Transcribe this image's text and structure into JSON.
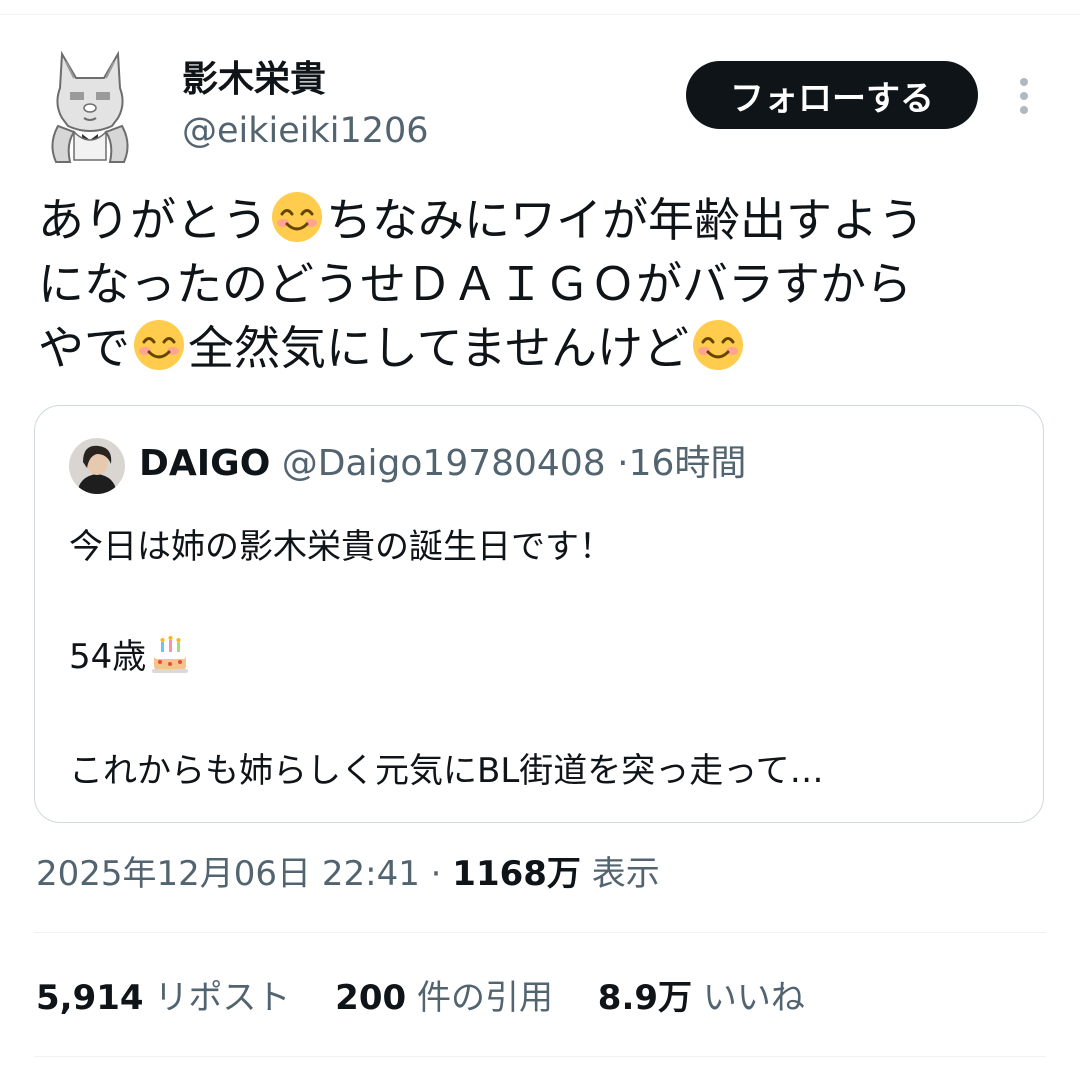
{
  "author": {
    "name": "影木栄貴",
    "handle": "@eikieiki1206",
    "follow_label": "フォローする"
  },
  "tweet": {
    "lines": [
      [
        "ありがとう",
        "",
        "ちなみにワイが年齢出すよう"
      ],
      [
        "になったのどうせＤＡＩＧＯがバラすから"
      ],
      [
        "やで",
        "",
        "全然気にしてませんけど",
        ""
      ]
    ],
    "emoji_icon": "smiling-face-emoji"
  },
  "quote": {
    "name": "DAIGO",
    "handle": "@Daigo19780408",
    "separator": "·",
    "time": "16時間",
    "lines": [
      "今日は姉の影木栄貴の誕生日です！",
      "54歳",
      "これからも姉らしく元気にBL街道を突っ走って…"
    ],
    "cake_icon": "birthday-cake-emoji"
  },
  "meta": {
    "timestamp": "2025年12月06日 22:41",
    "separator": "·",
    "views_count": "1168万",
    "views_label": "表示"
  },
  "stats": {
    "reposts_count": "5,914",
    "reposts_label": "リポスト",
    "quotes_count": "200",
    "quotes_label": "件の引用",
    "likes_count": "8.9万",
    "likes_label": "いいね"
  },
  "colors": {
    "text": "#0f1419",
    "secondary": "#536471",
    "border": "#cfd9de",
    "divider": "#eff3f4",
    "button_bg": "#0f1419"
  }
}
